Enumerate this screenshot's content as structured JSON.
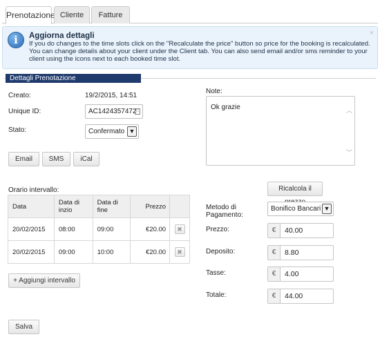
{
  "tabs": [
    {
      "label": "Prenotazione"
    },
    {
      "label": "Cliente"
    },
    {
      "label": "Fatture"
    }
  ],
  "info": {
    "title": "Aggiorna dettagli",
    "text": "If you do changes to the time slots click on the \"Recalculate the price\" button so price for the booking is recalculated. You can change details about your client under the Client tab. You can also send email and/or sms reminder to your client using the icons next to each booked time slot.",
    "close": "×"
  },
  "section": {
    "title": "Dettagli Prenotazione"
  },
  "details": {
    "created_label": "Creato:",
    "created_value": "19/2/2015, 14:51",
    "uid_label": "Unique ID:",
    "uid_value": "AC1424357472",
    "status_label": "Stato:",
    "status_value": "Confermato"
  },
  "actions": {
    "email": "Email",
    "sms": "SMS",
    "ical": "iCal"
  },
  "note": {
    "label": "Note:",
    "value": "Ok grazie"
  },
  "intervals": {
    "label": "Orario intervallo:",
    "headers": {
      "date": "Data",
      "start": "Data di inzio",
      "end": "Data di fine",
      "price": "Prezzo"
    },
    "rows": [
      {
        "date": "20/02/2015",
        "start": "08:00",
        "end": "09:00",
        "price": "€20.00"
      },
      {
        "date": "20/02/2015",
        "start": "09:00",
        "end": "10:00",
        "price": "€20.00"
      }
    ],
    "add_label": "+ Aggiungi intervallo"
  },
  "pricing": {
    "recalc_label": "Ricalcola il prezzo",
    "method_label": "Metodo di Pagamento:",
    "method_value": "Bonifico Bancari",
    "currency": "€",
    "price_label": "Prezzo:",
    "price_value": "40.00",
    "deposit_label": "Deposito:",
    "deposit_value": "8.80",
    "tax_label": "Tasse:",
    "tax_value": "4.00",
    "total_label": "Totale:",
    "total_value": "44.00"
  },
  "footer": {
    "save_label": "Salva"
  },
  "icons": {
    "info": "info-icon",
    "close": "close-icon",
    "dropdown": "chevron-down-icon",
    "delete": "delete-x-icon",
    "scroll_up": "chevron-up-icon",
    "scroll_down": "chevron-down-icon"
  }
}
